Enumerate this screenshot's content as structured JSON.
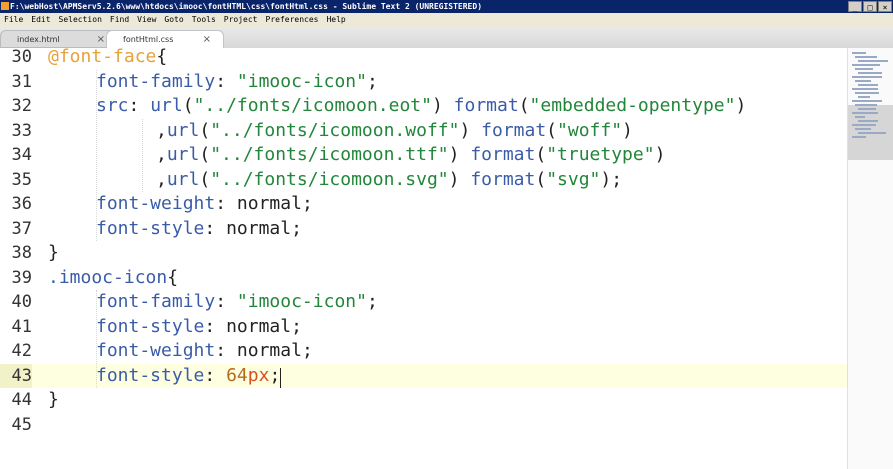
{
  "window": {
    "title": "F:\\webHost\\APMServ5.2.6\\www\\htdocs\\imooc\\fontHTML\\css\\fontHtml.css - Sublime Text 2 (UNREGISTERED)",
    "buttons": {
      "minimize": "_",
      "maximize": "□",
      "close": "×"
    }
  },
  "menu": [
    "File",
    "Edit",
    "Selection",
    "Find",
    "View",
    "Goto",
    "Tools",
    "Project",
    "Preferences",
    "Help"
  ],
  "tabs": [
    {
      "label": "index.html",
      "close": "×",
      "active": false
    },
    {
      "label": "fontHtml.css",
      "close": "×",
      "active": true
    }
  ],
  "editor": {
    "current_line": "43",
    "line_numbers": [
      "30",
      "31",
      "32",
      "33",
      "34",
      "35",
      "36",
      "37",
      "38",
      "39",
      "40",
      "41",
      "42",
      "43",
      "44",
      "45"
    ],
    "lines": [
      [
        {
          "t": "@font-face",
          "c": "at"
        },
        {
          "t": "{",
          "c": "punc"
        }
      ],
      [
        {
          "t": "font-family",
          "c": "prop"
        },
        {
          "t": ": ",
          "c": "punc"
        },
        {
          "t": "\"imooc-icon\"",
          "c": "str"
        },
        {
          "t": ";",
          "c": "punc"
        }
      ],
      [
        {
          "t": "src",
          "c": "prop"
        },
        {
          "t": ": ",
          "c": "punc"
        },
        {
          "t": "url",
          "c": "fn"
        },
        {
          "t": "(",
          "c": "punc"
        },
        {
          "t": "\"../fonts/icomoon.eot\"",
          "c": "str"
        },
        {
          "t": ") ",
          "c": "punc"
        },
        {
          "t": "format",
          "c": "fn"
        },
        {
          "t": "(",
          "c": "punc"
        },
        {
          "t": "\"embedded-opentype\"",
          "c": "str"
        },
        {
          "t": ")",
          "c": "punc"
        }
      ],
      [
        {
          "t": ",",
          "c": "punc"
        },
        {
          "t": "url",
          "c": "fn"
        },
        {
          "t": "(",
          "c": "punc"
        },
        {
          "t": "\"../fonts/icomoon.woff\"",
          "c": "str"
        },
        {
          "t": ") ",
          "c": "punc"
        },
        {
          "t": "format",
          "c": "fn"
        },
        {
          "t": "(",
          "c": "punc"
        },
        {
          "t": "\"woff\"",
          "c": "str"
        },
        {
          "t": ")",
          "c": "punc"
        }
      ],
      [
        {
          "t": ",",
          "c": "punc"
        },
        {
          "t": "url",
          "c": "fn"
        },
        {
          "t": "(",
          "c": "punc"
        },
        {
          "t": "\"../fonts/icomoon.ttf\"",
          "c": "str"
        },
        {
          "t": ") ",
          "c": "punc"
        },
        {
          "t": "format",
          "c": "fn"
        },
        {
          "t": "(",
          "c": "punc"
        },
        {
          "t": "\"truetype\"",
          "c": "str"
        },
        {
          "t": ")",
          "c": "punc"
        }
      ],
      [
        {
          "t": ",",
          "c": "punc"
        },
        {
          "t": "url",
          "c": "fn"
        },
        {
          "t": "(",
          "c": "punc"
        },
        {
          "t": "\"../fonts/icomoon.svg\"",
          "c": "str"
        },
        {
          "t": ") ",
          "c": "punc"
        },
        {
          "t": "format",
          "c": "fn"
        },
        {
          "t": "(",
          "c": "punc"
        },
        {
          "t": "\"svg\"",
          "c": "str"
        },
        {
          "t": ");",
          "c": "punc"
        }
      ],
      [
        {
          "t": "font-weight",
          "c": "prop"
        },
        {
          "t": ": ",
          "c": "punc"
        },
        {
          "t": "normal",
          "c": "val"
        },
        {
          "t": ";",
          "c": "punc"
        }
      ],
      [
        {
          "t": "font-style",
          "c": "prop"
        },
        {
          "t": ": ",
          "c": "punc"
        },
        {
          "t": "normal",
          "c": "val"
        },
        {
          "t": ";",
          "c": "punc"
        }
      ],
      [
        {
          "t": "}",
          "c": "punc"
        }
      ],
      [
        {
          "t": ".imooc-icon",
          "c": "sel"
        },
        {
          "t": "{",
          "c": "punc"
        }
      ],
      [
        {
          "t": "font-family",
          "c": "prop"
        },
        {
          "t": ": ",
          "c": "punc"
        },
        {
          "t": "\"imooc-icon\"",
          "c": "str"
        },
        {
          "t": ";",
          "c": "punc"
        }
      ],
      [
        {
          "t": "font-style",
          "c": "prop"
        },
        {
          "t": ": ",
          "c": "punc"
        },
        {
          "t": "normal",
          "c": "val"
        },
        {
          "t": ";",
          "c": "punc"
        }
      ],
      [
        {
          "t": "font-weight",
          "c": "prop"
        },
        {
          "t": ": ",
          "c": "punc"
        },
        {
          "t": "normal",
          "c": "val"
        },
        {
          "t": ";",
          "c": "punc"
        }
      ],
      [
        {
          "t": "font-style",
          "c": "prop"
        },
        {
          "t": ": ",
          "c": "punc"
        },
        {
          "t": "64",
          "c": "num"
        },
        {
          "t": "px",
          "c": "unit"
        },
        {
          "t": ";",
          "c": "punc"
        }
      ],
      [
        {
          "t": "}",
          "c": "punc"
        }
      ],
      []
    ]
  }
}
